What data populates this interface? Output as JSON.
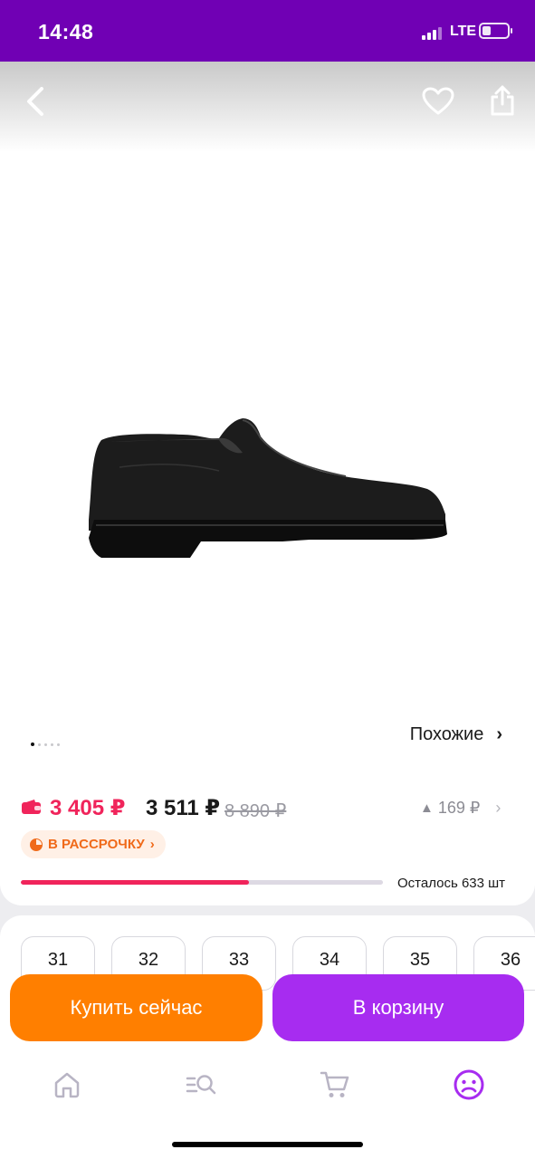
{
  "status_bar": {
    "time": "14:48",
    "network": "LTE",
    "battery_level": 0.3
  },
  "gallery": {
    "image": "black leather slip-on shoe",
    "total_images": 5,
    "active_image": 1,
    "similar_label": "Похожие",
    "icons": {
      "back": "chevron-left-icon",
      "favorite": "heart-icon",
      "share": "share-icon"
    }
  },
  "price": {
    "main": "3 405 ₽",
    "second": "3 511 ₽",
    "old": "8 890 ₽",
    "difference": "169 ₽",
    "installment_label": "В РАССРОЧКУ",
    "stock_label": "Осталось 633 шт",
    "stock_fraction": 0.63
  },
  "sizes": [
    "31",
    "32",
    "33",
    "34",
    "35",
    "36"
  ],
  "actions": {
    "buy_now": "Купить сейчас",
    "add_to_cart": "В корзину"
  },
  "nav": {
    "items": [
      "home-icon",
      "catalog-search-icon",
      "cart-icon",
      "profile-icon"
    ],
    "active": "profile-icon"
  },
  "colors": {
    "brand": "#7000b4",
    "accent_price": "#f0245b",
    "buy_button": "#ff7f00",
    "cart_button": "#a72cf0",
    "installment": "#f06a1a"
  }
}
